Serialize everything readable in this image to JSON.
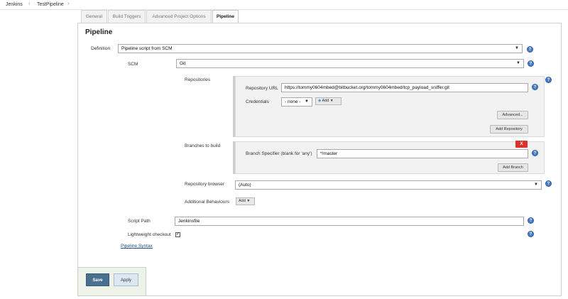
{
  "breadcrumb": {
    "items": [
      "Jenkins",
      "TestPipeline"
    ],
    "separator": "›"
  },
  "tabs": [
    {
      "label": "General",
      "active": false
    },
    {
      "label": "Build Triggers",
      "active": false
    },
    {
      "label": "Advanced Project Options",
      "active": false
    },
    {
      "label": "Pipeline",
      "active": true
    }
  ],
  "pipeline": {
    "title": "Pipeline",
    "definition_label": "Definition",
    "definition_value": "Pipeline script from SCM",
    "scm_label": "SCM",
    "scm_value": "Git",
    "repositories_label": "Repositories",
    "repository_url_label": "Repository URL",
    "repository_url_value": "https://tommy0604mbed@bitbucket.org/tommy0604mbed/tcp_payload_sniffer.git",
    "credentials_label": "Credentials",
    "credentials_value": "- none -",
    "add_credentials_label": "Add",
    "advanced_label": "Advanced...",
    "add_repository_label": "Add Repository",
    "branches_label": "Branches to build",
    "branch_specifier_label": "Branch Specifier (blank for 'any')",
    "branch_specifier_value": "*/master",
    "delete_label": "X",
    "add_branch_label": "Add Branch",
    "repo_browser_label": "Repository browser",
    "repo_browser_value": "(Auto)",
    "additional_behaviours_label": "Additional Behaviours",
    "add_behaviour_label": "Add",
    "script_path_label": "Script Path",
    "script_path_value": "Jenkinsfile",
    "lightweight_checkout_label": "Lightweight checkout",
    "lightweight_checkout_checked": true,
    "pipeline_syntax_label": "Pipeline Syntax"
  },
  "actions": {
    "save_label": "Save",
    "apply_label": "Apply"
  },
  "help_icon_glyph": "?",
  "caret_glyph": "▼",
  "check_glyph": "✓",
  "colors": {
    "link": "#204a87",
    "save_bg": "#4a7090",
    "apply_bg": "#dbe7f2",
    "delete_bg": "#d9342b",
    "help_bg": "#4a7ac4"
  }
}
